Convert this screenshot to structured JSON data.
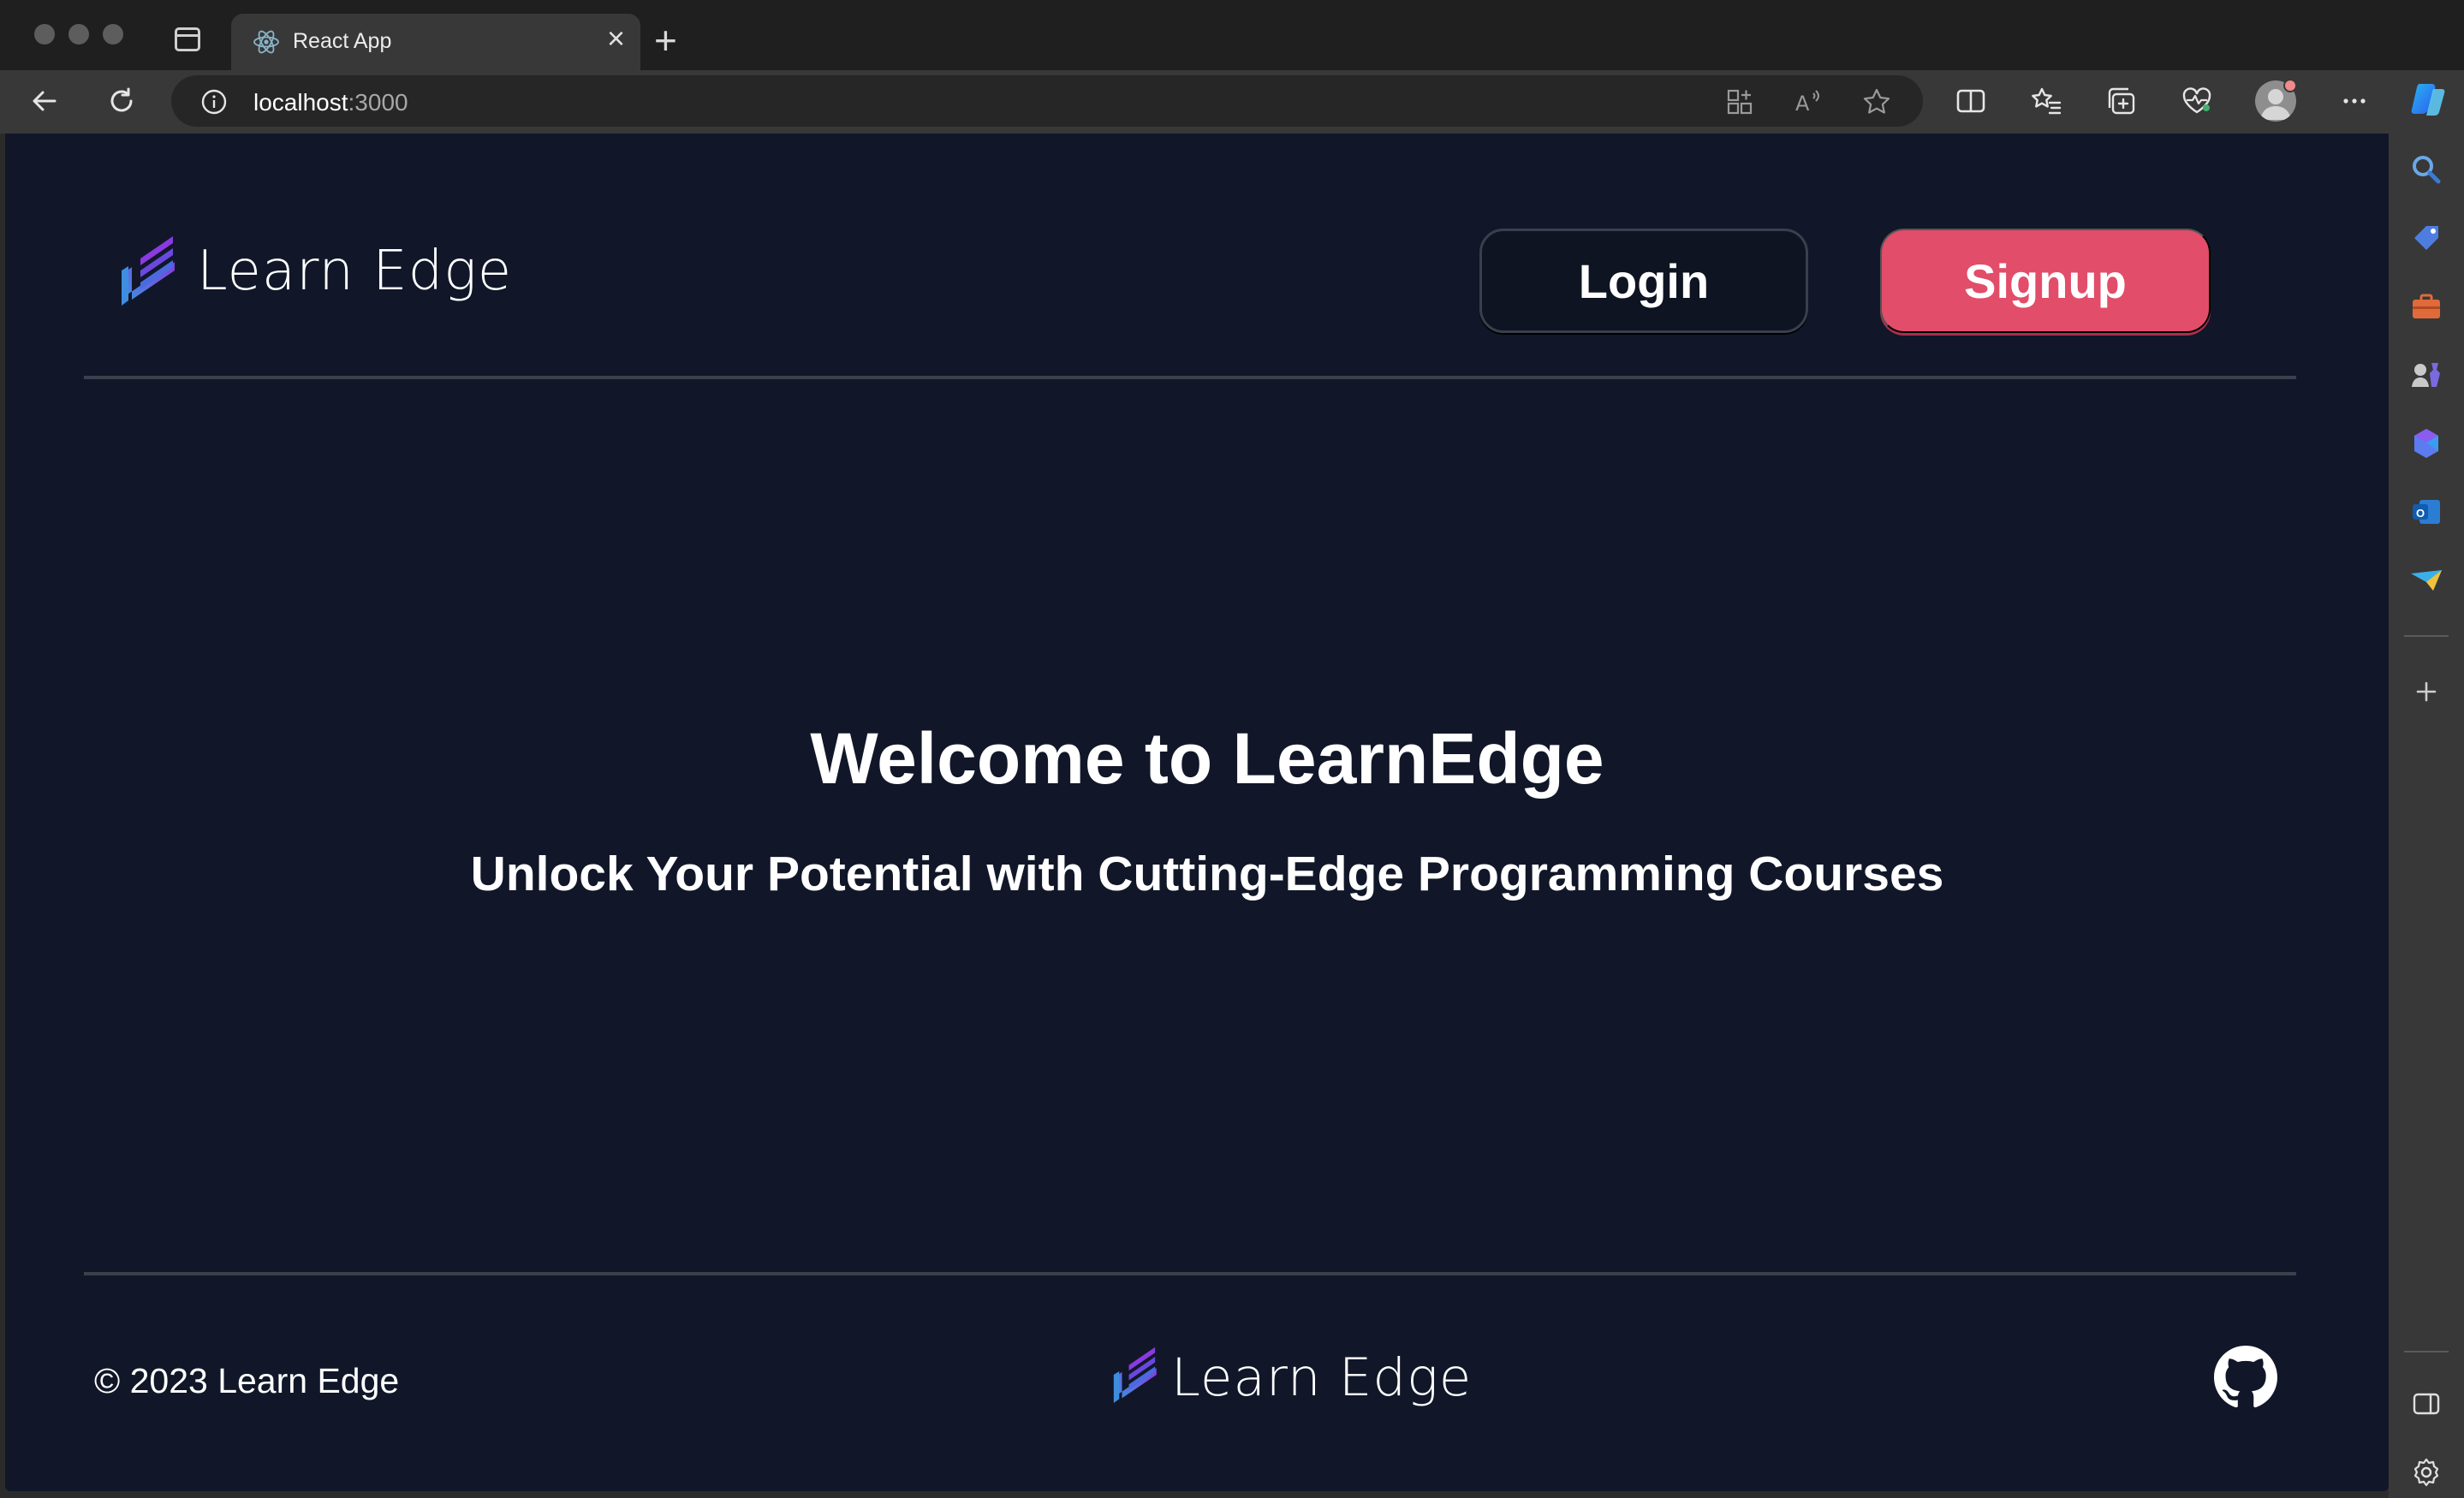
{
  "browser": {
    "tab_title": "React App",
    "tab_close": "×",
    "new_tab": "+",
    "url_host": "localhost",
    "url_port": ":3000",
    "icons": [
      "back-arrow-icon",
      "refresh-icon",
      "info-icon",
      "apps-icon",
      "read-aloud-icon",
      "favorite-star-icon",
      "split-screen-icon",
      "favorites-icon",
      "collections-icon",
      "browser-essentials-icon",
      "profile-avatar-icon",
      "more-menu-icon",
      "copilot-icon"
    ],
    "sidebar_icons": [
      "search-icon",
      "shopping-tag-icon",
      "tools-icon",
      "games-icon",
      "microsoft-365-icon",
      "outlook-icon",
      "drop-icon",
      "add-icon",
      "hide-sidebar-icon",
      "settings-icon"
    ]
  },
  "header": {
    "brand": "Learn Edge",
    "login_label": "Login",
    "signup_label": "Signup"
  },
  "hero": {
    "title": "Welcome to LearnEdge",
    "subtitle": "Unlock Your Potential with Cutting-Edge Programming Courses"
  },
  "footer": {
    "copyright": "© 2023 Learn Edge",
    "brand": "Learn Edge"
  },
  "colors": {
    "page_bg": "#111729",
    "signup": "#e24d6a",
    "divider": "#3b404c"
  }
}
